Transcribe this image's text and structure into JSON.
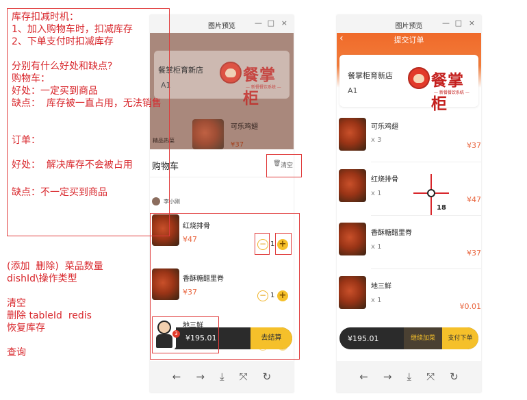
{
  "notes_box": {
    "title": "库存扣减时机：",
    "opt1": "1、加入购物车时，扣减库存",
    "opt2": "2、下单支付时扣减库存",
    "question": "分别有什么好处和缺点?",
    "cart_heading": "购物车：",
    "cart_pro": "好处：一定买到商品",
    "cart_con": "缺点：  库存被一直占用，无法销售",
    "order_heading": "订单：",
    "order_pro": "好处：  解决库存不会被占用",
    "order_con": "缺点：不一定买到商品"
  },
  "left_notes": {
    "line1": "(添加  删除)  菜品数量",
    "line2": "dishId\\操作类型",
    "line3": "清空",
    "line4": "删除 tableId  redis",
    "line5": "恢复库存",
    "line6": "查询"
  },
  "window_left": {
    "title": "图片预览",
    "controls": [
      "—",
      "□",
      "×"
    ],
    "shop_name": "餐掌柜育新店",
    "shop_sub": "A1",
    "logo_text": "餐掌柜",
    "logo_tag": "— 新餐餐饮系统 —",
    "bg_category": "精品热菜",
    "bg_dish": "可乐鸡翅",
    "bg_price": "¥37",
    "cart_title": "购物车",
    "clear_label": "清空",
    "user_name": "李小刚",
    "items": [
      {
        "name": "红烧排骨",
        "price": "¥47",
        "count": "1"
      },
      {
        "name": "香酥糖醋里脊",
        "price": "¥37",
        "count": "1"
      },
      {
        "name": "地三鲜",
        "price": "",
        "count": ""
      }
    ],
    "badge": "3",
    "total": "¥195.01",
    "checkout": "去结算",
    "nav": [
      "←",
      "→",
      "⤓",
      "⤧",
      "↻"
    ]
  },
  "window_right": {
    "title": "图片预览",
    "controls": [
      "—",
      "□",
      "×"
    ],
    "header_title": "提交订单",
    "shop_name": "餐掌柜育新店",
    "shop_sub": "A1",
    "logo_text": "餐掌柜",
    "logo_tag": "— 新餐餐饮系统 —",
    "items": [
      {
        "name": "可乐鸡翅",
        "qty": "x 3",
        "price": "¥37"
      },
      {
        "name": "红烧排骨",
        "qty": "x 1",
        "price": "¥47"
      },
      {
        "name": "香酥糖醋里脊",
        "qty": "x 1",
        "price": "¥37"
      },
      {
        "name": "地三鲜",
        "qty": "x 1",
        "price": "¥0.01"
      }
    ],
    "cursor_label": "18",
    "total": "¥195.01",
    "continue_btn": "继续加菜",
    "pay_btn": "支付下单",
    "nav": [
      "←",
      "→",
      "⤓",
      "⤧",
      "↻"
    ]
  },
  "colors": {
    "annotation": "#d8262b",
    "accent": "#f5c02a",
    "price": "#e8633c",
    "header_orange": "#f06a2a"
  }
}
